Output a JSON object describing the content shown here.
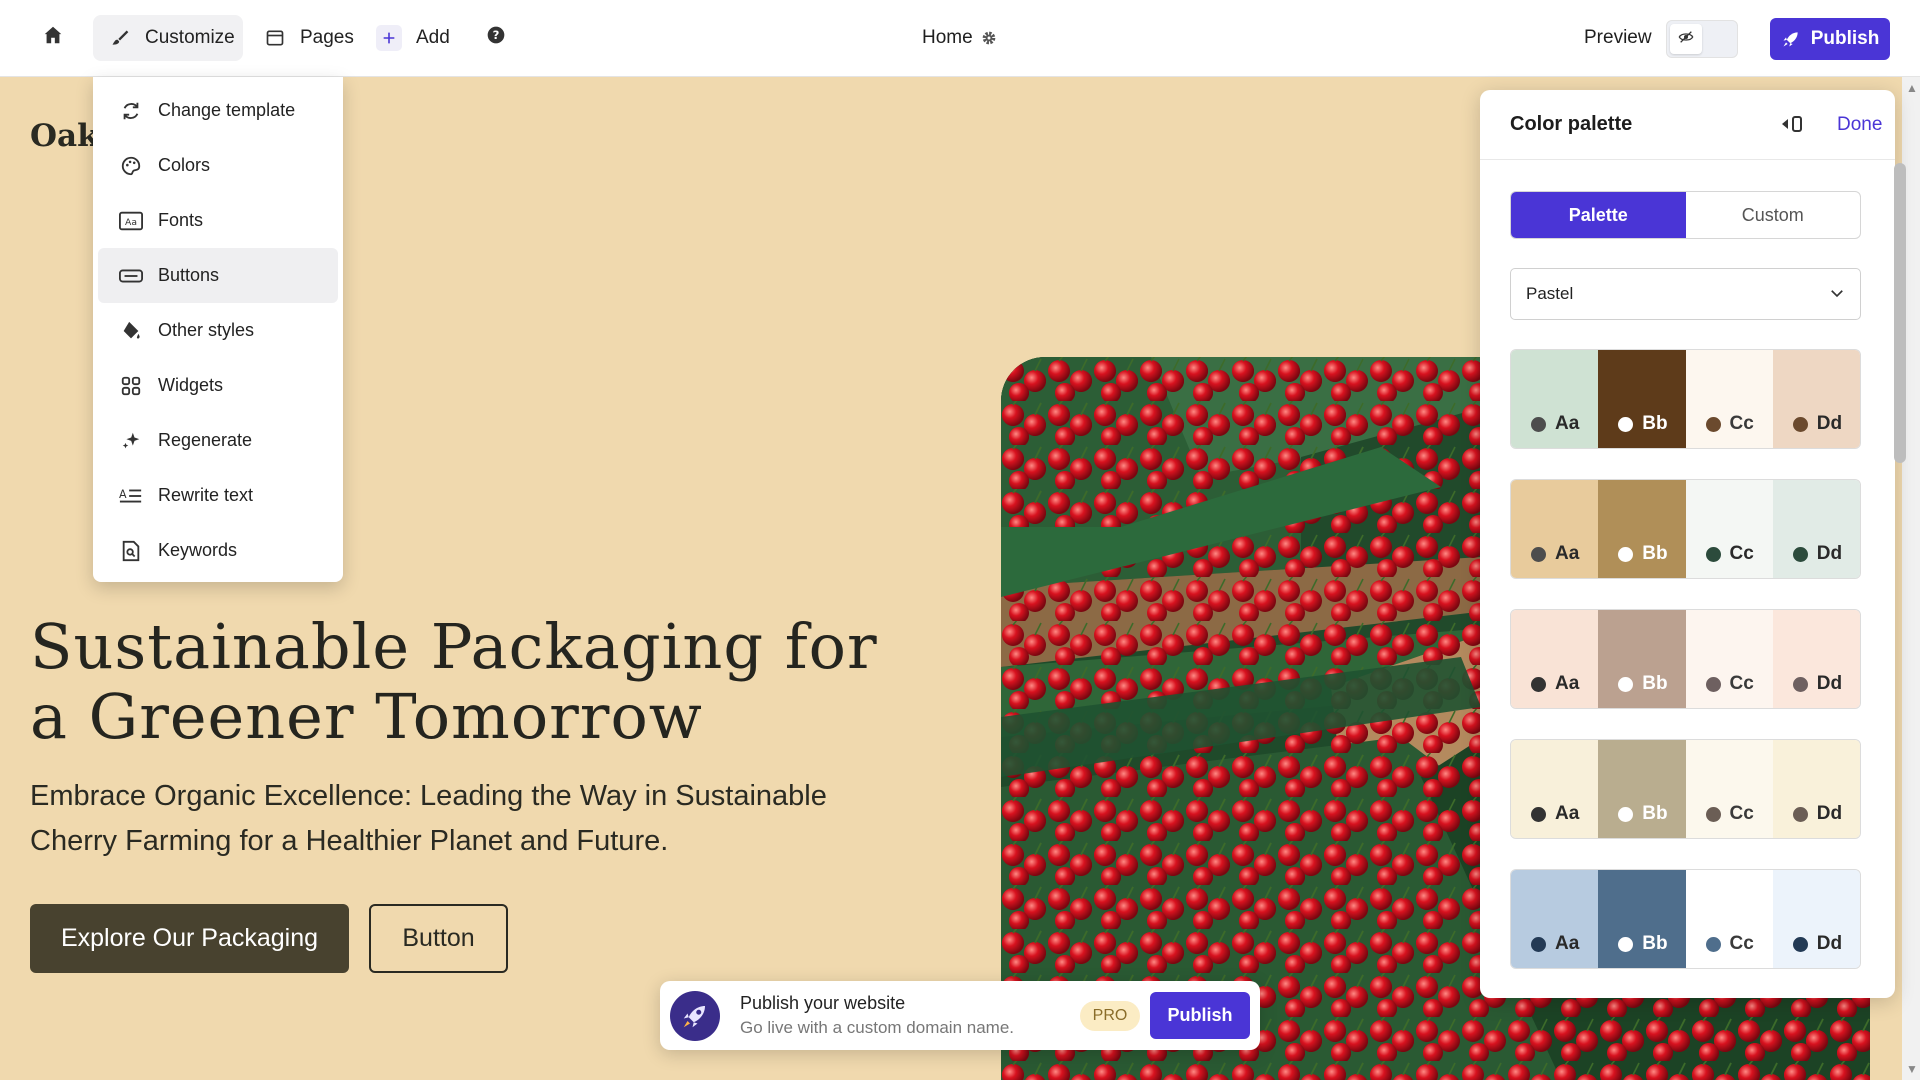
{
  "topbar": {
    "customize_label": "Customize",
    "pages_label": "Pages",
    "add_label": "Add",
    "page_name": "Home",
    "preview_label": "Preview",
    "publish_label": "Publish",
    "accent_color": "#4a35d6"
  },
  "customize_menu": {
    "items": [
      {
        "label": "Change template",
        "icon": "refresh-icon"
      },
      {
        "label": "Colors",
        "icon": "palette-icon"
      },
      {
        "label": "Fonts",
        "icon": "font-icon"
      },
      {
        "label": "Buttons",
        "icon": "button-icon"
      },
      {
        "label": "Other styles",
        "icon": "paint-bucket-icon"
      },
      {
        "label": "Widgets",
        "icon": "widgets-icon"
      },
      {
        "label": "Regenerate",
        "icon": "sparkle-icon"
      },
      {
        "label": "Rewrite text",
        "icon": "rewrite-icon"
      },
      {
        "label": "Keywords",
        "icon": "keyword-doc-icon"
      }
    ],
    "active_item": "Buttons"
  },
  "site": {
    "logo_text": "Oak",
    "hero_title": "Sustainable Packaging for a Greener Tomorrow",
    "hero_subtitle": "Embrace Organic Excellence: Leading the Way in Sustainable Cherry Farming for a Healthier Planet and Future.",
    "primary_button": "Explore Our Packaging",
    "secondary_button": "Button",
    "background_color": "#f0d9ae"
  },
  "color_panel": {
    "title": "Color palette",
    "done_label": "Done",
    "tabs": [
      "Palette",
      "Custom"
    ],
    "active_tab": "Palette",
    "selected_palette": "Pastel",
    "palettes": [
      [
        {
          "label": "Aa",
          "bg": "#cfe2d3",
          "dot": "#4d4d4d",
          "text": "#2a2a2a"
        },
        {
          "label": "Bb",
          "bg": "#5e3b1a",
          "dot": "#ffffff",
          "text": "#ffffff"
        },
        {
          "label": "Cc",
          "bg": "#fdf7ef",
          "dot": "#6b4a2e",
          "text": "#3a3a3a"
        },
        {
          "label": "Dd",
          "bg": "#eed7c3",
          "dot": "#6b4a2e",
          "text": "#2a2a2a"
        }
      ],
      [
        {
          "label": "Aa",
          "bg": "#e8cb9c",
          "dot": "#4d4d4d",
          "text": "#2a2a2a"
        },
        {
          "label": "Bb",
          "bg": "#b08f58",
          "dot": "#ffffff",
          "text": "#ffffff"
        },
        {
          "label": "Cc",
          "bg": "#f4f7f4",
          "dot": "#2c4b3c",
          "text": "#2a2a2a"
        },
        {
          "label": "Dd",
          "bg": "#e1ebe6",
          "dot": "#2c4b3c",
          "text": "#2a2a2a"
        }
      ],
      [
        {
          "label": "Aa",
          "bg": "#f9e3d6",
          "dot": "#333333",
          "text": "#2a2a2a"
        },
        {
          "label": "Bb",
          "bg": "#bba190",
          "dot": "#ffffff",
          "text": "#ffffff"
        },
        {
          "label": "Cc",
          "bg": "#fdf5ef",
          "dot": "#6e6060",
          "text": "#3a3a3a"
        },
        {
          "label": "Dd",
          "bg": "#fbe7dc",
          "dot": "#6e6060",
          "text": "#2a2a2a"
        }
      ],
      [
        {
          "label": "Aa",
          "bg": "#f8f0da",
          "dot": "#333333",
          "text": "#2a2a2a"
        },
        {
          "label": "Bb",
          "bg": "#b9ad8f",
          "dot": "#ffffff",
          "text": "#ffffff"
        },
        {
          "label": "Cc",
          "bg": "#fcf8ed",
          "dot": "#6b5e55",
          "text": "#3a3a3a"
        },
        {
          "label": "Dd",
          "bg": "#f9f1da",
          "dot": "#6b5e55",
          "text": "#2a2a2a"
        }
      ],
      [
        {
          "label": "Aa",
          "bg": "#b7cbe0",
          "dot": "#233a55",
          "text": "#2a2a2a"
        },
        {
          "label": "Bb",
          "bg": "#4f6e8c",
          "dot": "#ffffff",
          "text": "#ffffff"
        },
        {
          "label": "Cc",
          "bg": "#ffffff",
          "dot": "#4f6e8c",
          "text": "#3a3a3a"
        },
        {
          "label": "Dd",
          "bg": "#ecf3fb",
          "dot": "#233a55",
          "text": "#2a2a2a"
        }
      ]
    ]
  },
  "toast": {
    "title": "Publish your website",
    "subtitle": "Go live with a custom domain name.",
    "badge": "PRO",
    "button": "Publish"
  }
}
